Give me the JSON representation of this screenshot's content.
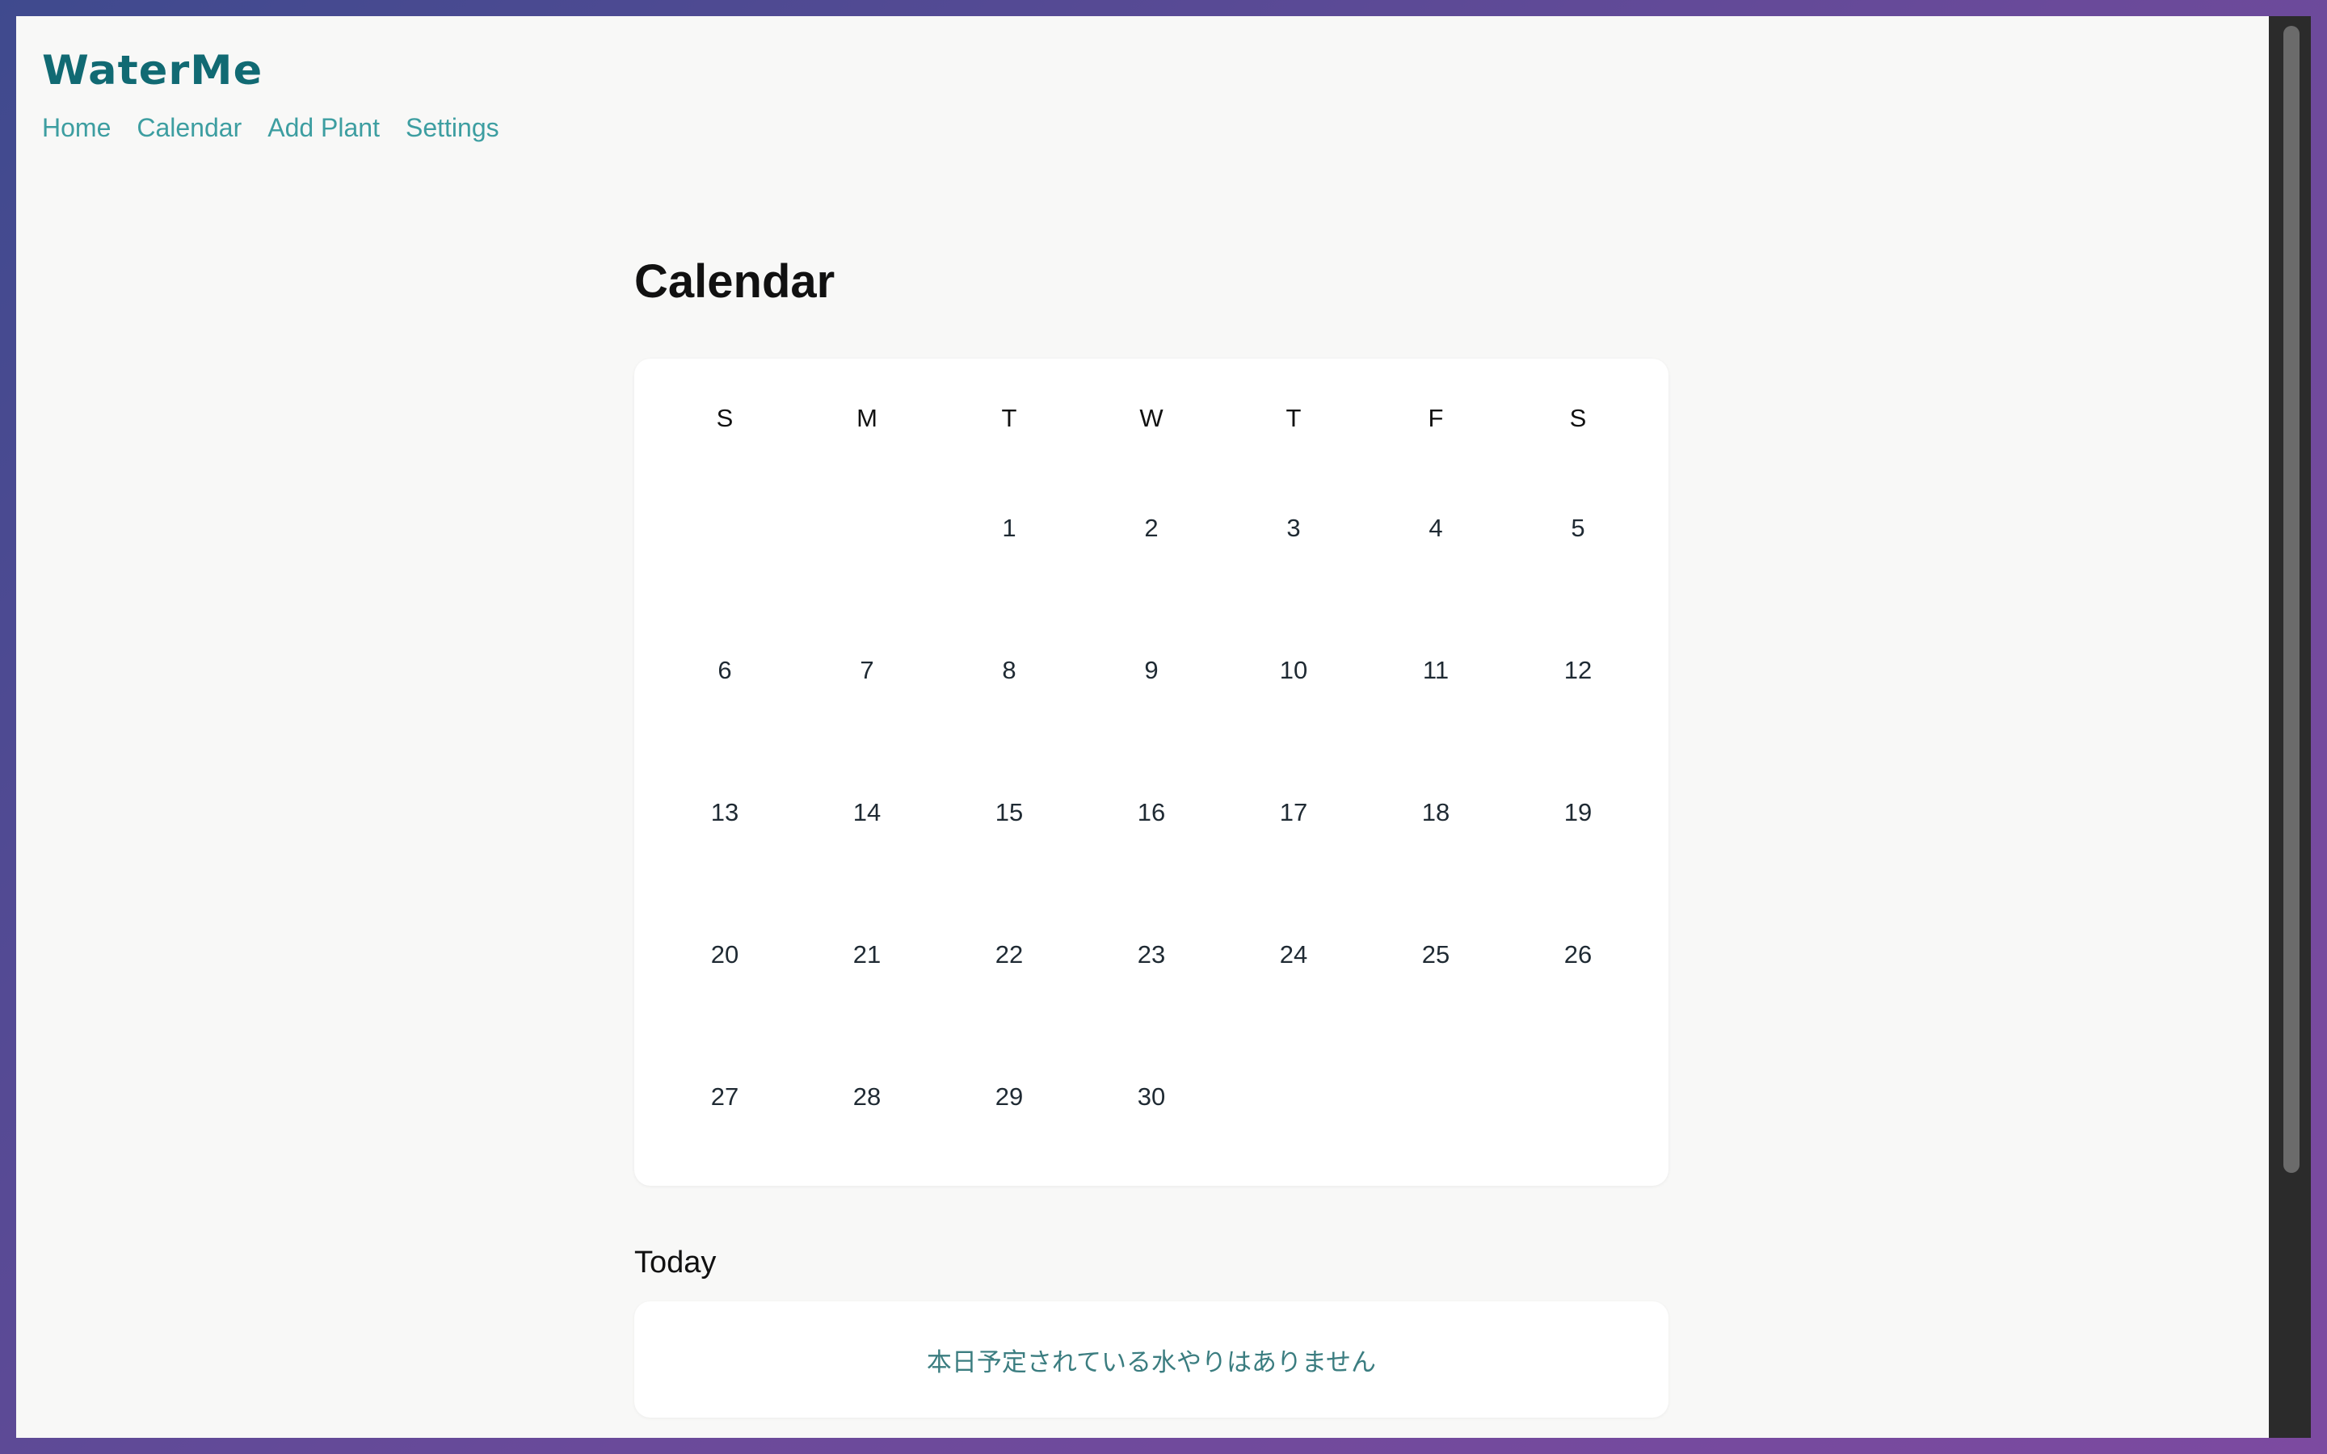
{
  "app": {
    "title": "WaterMe"
  },
  "nav": {
    "items": [
      {
        "label": "Home"
      },
      {
        "label": "Calendar"
      },
      {
        "label": "Add Plant"
      },
      {
        "label": "Settings"
      }
    ]
  },
  "page": {
    "title": "Calendar"
  },
  "calendar": {
    "weekdays": [
      "S",
      "M",
      "T",
      "W",
      "T",
      "F",
      "S"
    ],
    "weeks": [
      [
        "",
        "",
        "1",
        "2",
        "3",
        "4",
        "5"
      ],
      [
        "6",
        "7",
        "8",
        "9",
        "10",
        "11",
        "12"
      ],
      [
        "13",
        "14",
        "15",
        "16",
        "17",
        "18",
        "19"
      ],
      [
        "20",
        "21",
        "22",
        "23",
        "24",
        "25",
        "26"
      ],
      [
        "27",
        "28",
        "29",
        "30",
        "",
        "",
        ""
      ]
    ]
  },
  "today": {
    "title": "Today",
    "empty_message": "本日予定されている水やりはありません"
  },
  "colors": {
    "brand": "#116a73",
    "nav_link": "#3d9ea1",
    "empty_message": "#3b7d80",
    "page_background": "#f8f8f7"
  }
}
